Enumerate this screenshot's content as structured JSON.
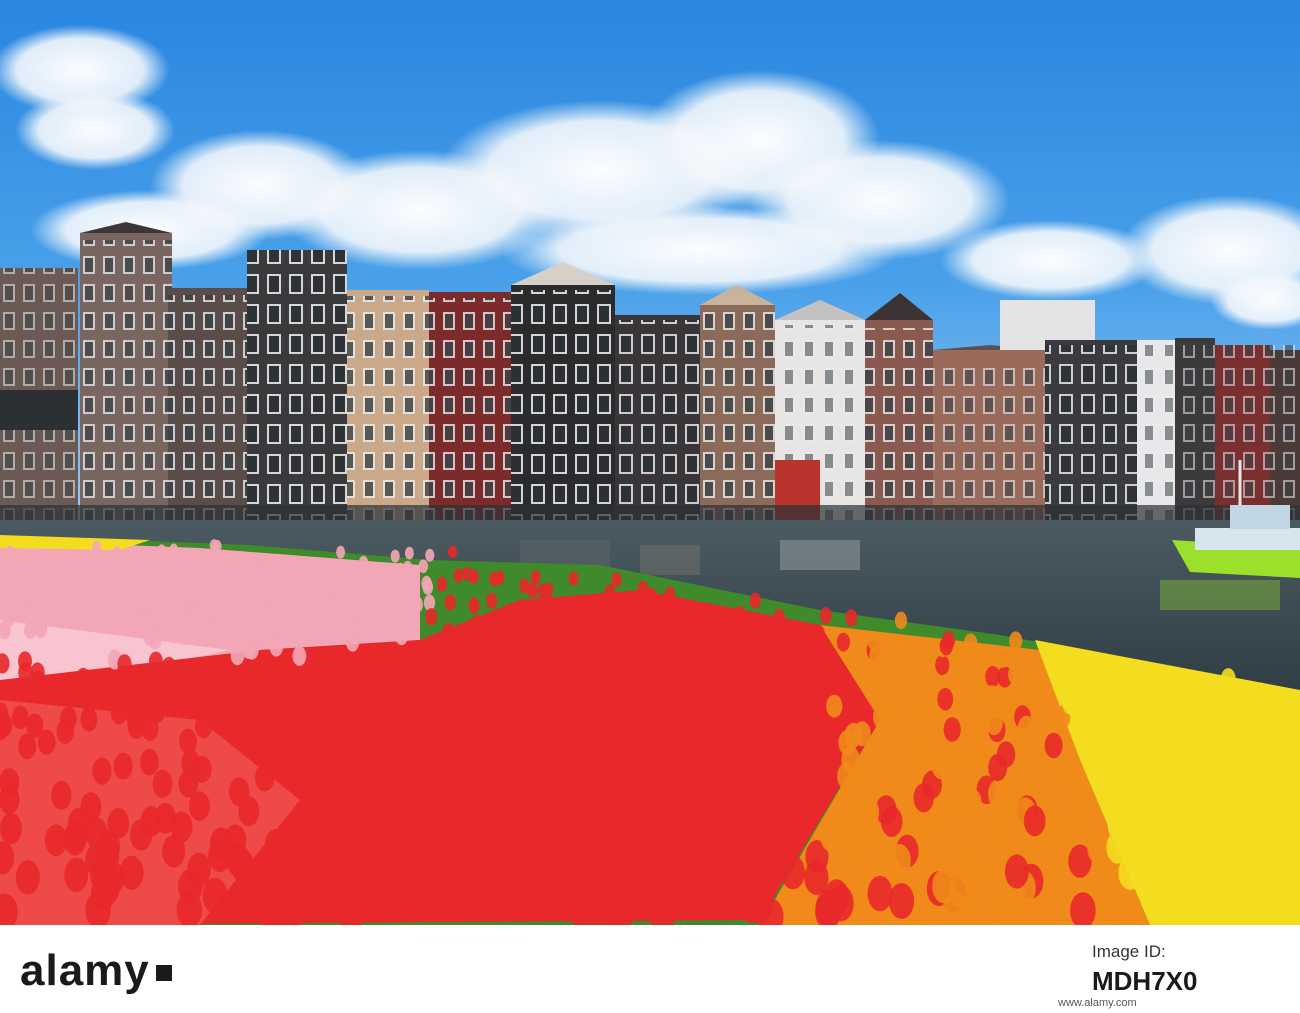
{
  "image": {
    "scene": "amsterdam-canal-houses-with-tulip-field",
    "colors": {
      "sky_top": "#2f8be3",
      "sky_bottom": "#8fc4ee",
      "water": "#3d4f56",
      "tulip_red": "#e8282a",
      "tulip_pink": "#f3a6b6",
      "tulip_yellow": "#f4dc1e",
      "tulip_orange": "#f08a1a",
      "leaf_green": "#3f8a2a",
      "boat_green": "#9be02a"
    }
  },
  "watermark": {
    "brand": "alamy",
    "id_label": "Image ID:",
    "id_value": "MDH7X0",
    "url": "www.alamy.com"
  }
}
